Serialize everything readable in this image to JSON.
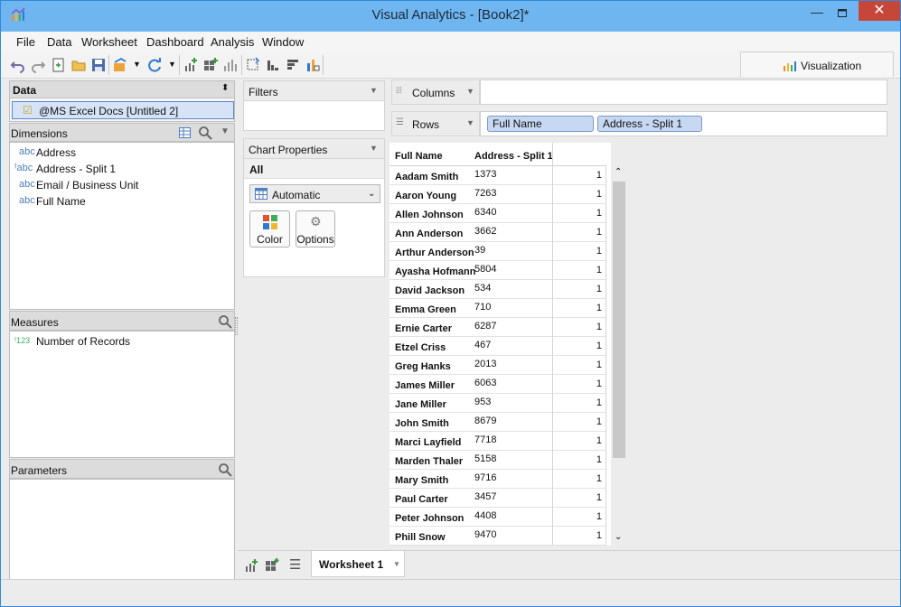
{
  "window": {
    "title": "Visual Analytics - [Book2]*"
  },
  "menu": [
    "File",
    "Data",
    "Worksheet",
    "Dashboard",
    "Analysis",
    "Window"
  ],
  "visualization_tab": "Visualization",
  "data_panel": {
    "header": "Data",
    "source": "@MS Excel Docs [Untitled 2]"
  },
  "dimensions": {
    "header": "Dimensions",
    "items": [
      {
        "type": "abc",
        "label": "Address"
      },
      {
        "type": "abc",
        "label": "Address - Split 1"
      },
      {
        "type": "abc",
        "label": "Email / Business Unit"
      },
      {
        "type": "abc",
        "label": "Full Name"
      }
    ]
  },
  "measures": {
    "header": "Measures",
    "items": [
      {
        "type": "123",
        "label": "Number of Records"
      }
    ]
  },
  "parameters": {
    "header": "Parameters"
  },
  "filters": {
    "header": "Filters"
  },
  "chart_properties": {
    "header": "Chart Properties",
    "scope": "All",
    "mark_type": "Automatic",
    "buttons": [
      "Color",
      "Options"
    ]
  },
  "shelves": {
    "columns_label": "Columns",
    "rows_label": "Rows",
    "row_pills": [
      "Full Name",
      "Address - Split 1"
    ]
  },
  "table": {
    "headers": [
      "Full Name",
      "Address - Split 1"
    ],
    "rows": [
      [
        "Aadam Smith",
        "1373",
        "1"
      ],
      [
        "Aaron Young",
        "7263",
        "1"
      ],
      [
        "Allen Johnson",
        "6340",
        "1"
      ],
      [
        "Ann Anderson",
        "3662",
        "1"
      ],
      [
        "Arthur Anderson",
        "39",
        "1"
      ],
      [
        "Ayasha Hofmann",
        "5804",
        "1"
      ],
      [
        "David Jackson",
        "534",
        "1"
      ],
      [
        "Emma Green",
        "710",
        "1"
      ],
      [
        "Ernie Carter",
        "6287",
        "1"
      ],
      [
        "Etzel Criss",
        "467",
        "1"
      ],
      [
        "Greg Hanks",
        "2013",
        "1"
      ],
      [
        "James Miller",
        "6063",
        "1"
      ],
      [
        "Jane Miller",
        "953",
        "1"
      ],
      [
        "John Smith",
        "8679",
        "1"
      ],
      [
        "Marci Layfield",
        "7718",
        "1"
      ],
      [
        "Marden Thaler",
        "5158",
        "1"
      ],
      [
        "Mary Smith",
        "9716",
        "1"
      ],
      [
        "Paul Carter",
        "3457",
        "1"
      ],
      [
        "Peter Johnson",
        "4408",
        "1"
      ],
      [
        "Phill Snow",
        "9470",
        "1"
      ]
    ]
  },
  "sheet_tab": "Worksheet 1",
  "colors": {
    "titlebar": "#6fb6f0",
    "close": "#c7463a",
    "pill": "#c7d8f2",
    "accent": "#4d7fc0"
  }
}
